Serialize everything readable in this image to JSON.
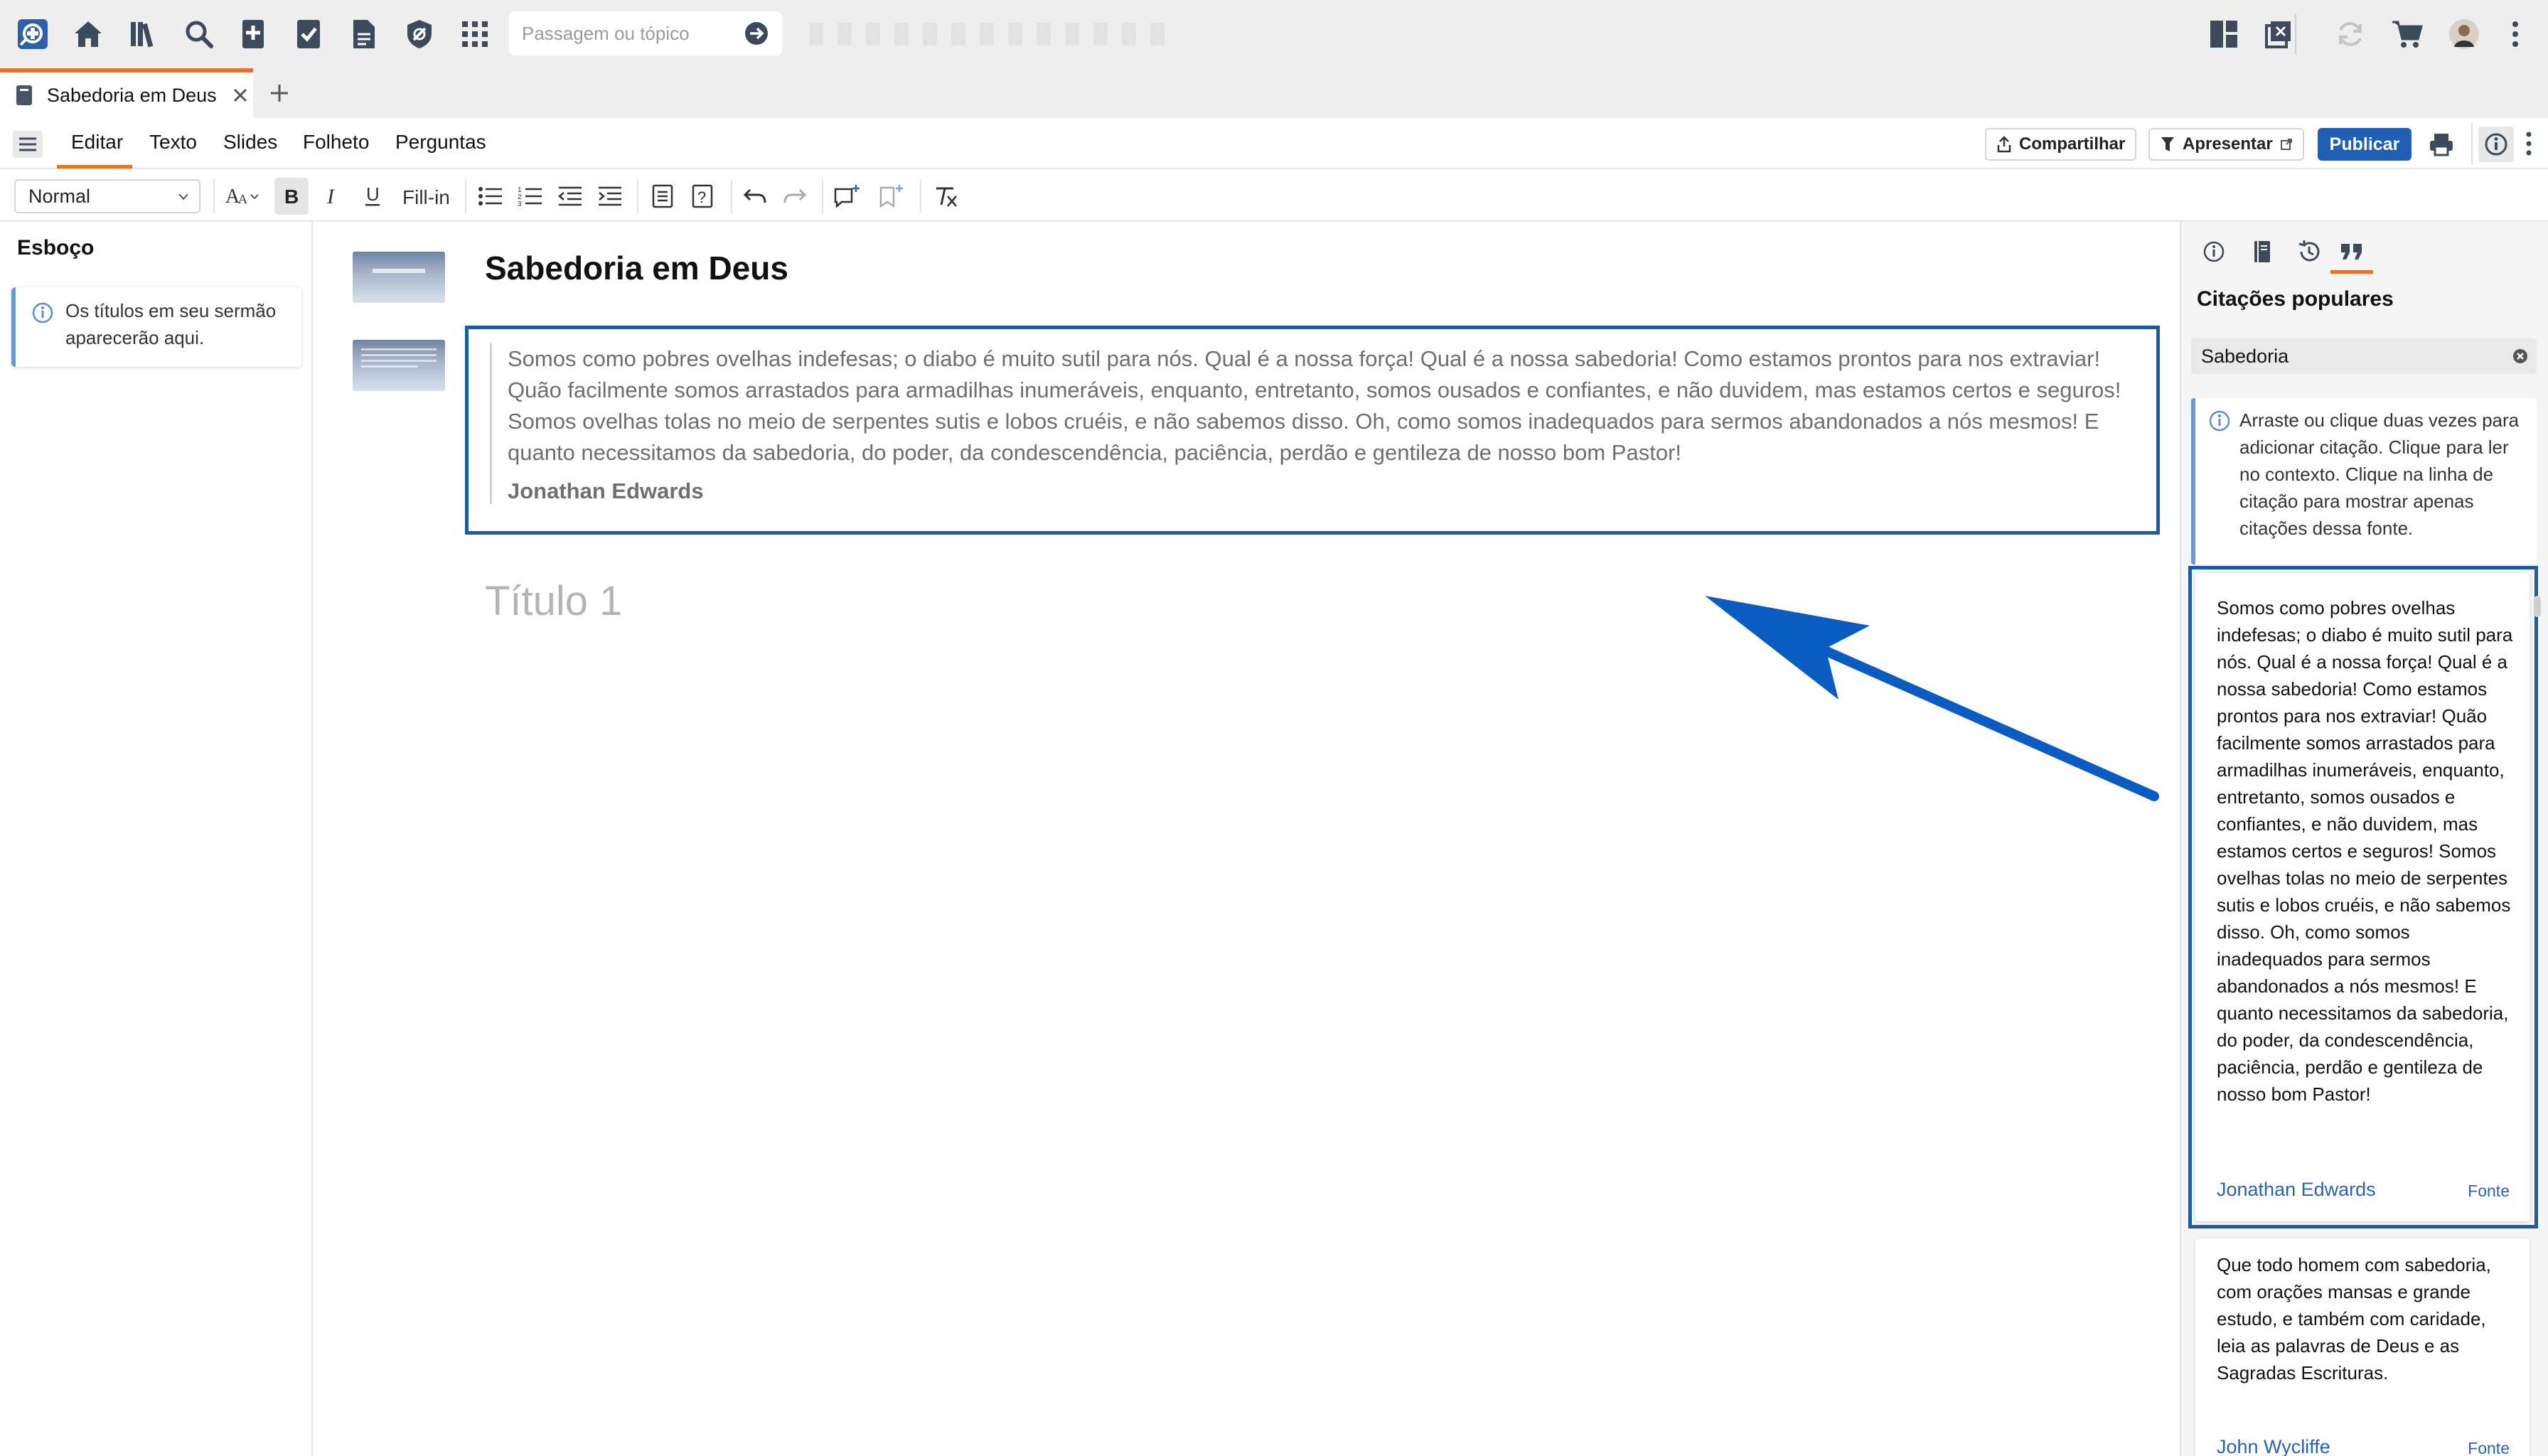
{
  "topbar": {
    "search_placeholder": "Passagem ou tópico",
    "icons": [
      "logos-app-icon",
      "home-icon",
      "library-icon",
      "search-icon",
      "add-document-icon",
      "checklist-icon",
      "document-icon",
      "shield-icon",
      "apps-grid-icon",
      "layout-icon",
      "external-window-icon",
      "sync-icon",
      "cart-icon",
      "avatar",
      "more-icon"
    ]
  },
  "tab": {
    "title": "Sabedoria em Deus"
  },
  "menu": {
    "items": [
      "Editar",
      "Texto",
      "Slides",
      "Folheto",
      "Perguntas"
    ],
    "share_label": "Compartilhar",
    "present_label": "Apresentar",
    "publish_label": "Publicar"
  },
  "format": {
    "style_value": "Normal",
    "fillin_label": "Fill-in"
  },
  "outline": {
    "title": "Esboço",
    "info_text": "Os títulos em seu sermão aparecerão aqui."
  },
  "editor": {
    "title": "Sabedoria em Deus",
    "quote_text": "Somos como pobres ovelhas indefesas; o diabo é muito sutil para nós. Qual é a nossa força! Qual é a nossa sabedoria! Como estamos prontos para nos extraviar! Quão facilmente somos arrastados para armadilhas inumeráveis, enquanto, entretanto, somos ousados e confiantes, e não duvidem, mas estamos certos e seguros! Somos ovelhas tolas no meio de serpentes sutis e lobos cruéis, e não sabemos disso. Oh, como somos inadequados para sermos abandonados a nós mesmos! E quanto necessitamos da sabedoria, do poder, da condescendência, paciência, perdão e gentileza de nosso bom Pastor!",
    "quote_author": "Jonathan Edwards",
    "heading_placeholder": "Título 1"
  },
  "right_panel": {
    "title": "Citações populares",
    "search_value": "Sabedoria",
    "info_text": "Arraste ou clique duas vezes para adicionar citação. Clique para ler no contexto. Clique na linha de citação para mostrar apenas citações dessa fonte.",
    "quotes": [
      {
        "text": "Somos como pobres ovelhas indefesas; o diabo é muito sutil para nós. Qual é a nossa força! Qual é a nossa sabedoria! Como estamos prontos para nos extraviar! Quão facilmente somos arrastados para armadilhas inumeráveis, enquanto, entretanto, somos ousados e confiantes, e não duvidem, mas estamos certos e seguros! Somos ovelhas tolas no meio de serpentes sutis e lobos cruéis, e não sabemos disso. Oh, como somos inadequados para sermos abandonados a nós mesmos! E quanto necessitamos da sabedoria, do poder, da condescendência, paciência, perdão e gentileza de nosso bom Pastor!",
        "author": "Jonathan Edwards",
        "source_label": "Fonte"
      },
      {
        "text": "Que todo homem com sabedoria, com orações mansas e grande estudo, e também com caridade, leia as palavras de Deus e as Sagradas Escrituras.",
        "author": "John Wycliffe",
        "source_label": "Fonte"
      }
    ]
  },
  "colors": {
    "accent_orange": "#e8702a",
    "highlight_blue": "#1a5aa6",
    "publish_blue": "#1f5fb5",
    "link_blue": "#2a63ad"
  }
}
